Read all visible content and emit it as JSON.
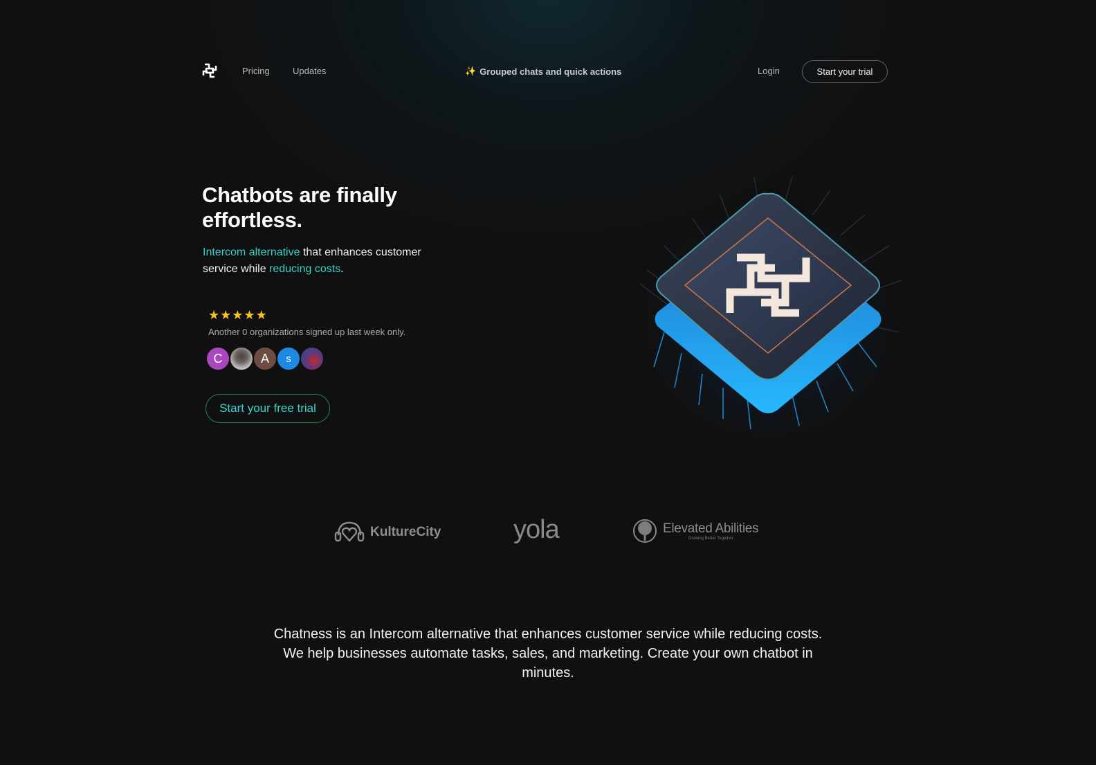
{
  "nav": {
    "logo": "chatness-logo",
    "links": [
      {
        "label": "Pricing"
      },
      {
        "label": "Updates"
      }
    ],
    "announcement": {
      "icon": "sparkle-icon",
      "text": "Grouped chats and quick actions"
    },
    "login_label": "Login",
    "trial_label": "Start your trial"
  },
  "hero": {
    "title": "Chatbots are finally effortless.",
    "subtitle": {
      "part1_accent": "Intercom alternative",
      "part2": " that enhances customer service while ",
      "part3_accent": "reducing costs",
      "part4": "."
    },
    "rating": 5,
    "rating_max": 5,
    "signup_note": "Another 0 organizations signed up last week only.",
    "avatars": [
      {
        "type": "initial",
        "label": "C",
        "color": "#ab47bc"
      },
      {
        "type": "photo",
        "label": ""
      },
      {
        "type": "initial",
        "label": "A",
        "color": "#6d4c41"
      },
      {
        "type": "initial",
        "label": "s",
        "color": "#1e88e5"
      },
      {
        "type": "photo",
        "label": ""
      }
    ],
    "cta_label": "Start your free trial",
    "illustration": "chip-logo-illustration"
  },
  "customers": [
    {
      "name": "KultureCity",
      "icon": "headphones-heart-icon"
    },
    {
      "name": "yola",
      "icon": ""
    },
    {
      "name": "Elevated Abilities",
      "tagline": "Growing Better Together",
      "icon": "tree-icon"
    }
  ],
  "about": {
    "text": "Chatness is an Intercom alternative that enhances customer service while reducing costs. We help businesses automate tasks, sales, and marketing. Create your own chatbot in minutes."
  },
  "colors": {
    "background": "#101010",
    "accent": "#35d0c9",
    "star": "#f5c518",
    "sparkle": "#f2c14e"
  }
}
